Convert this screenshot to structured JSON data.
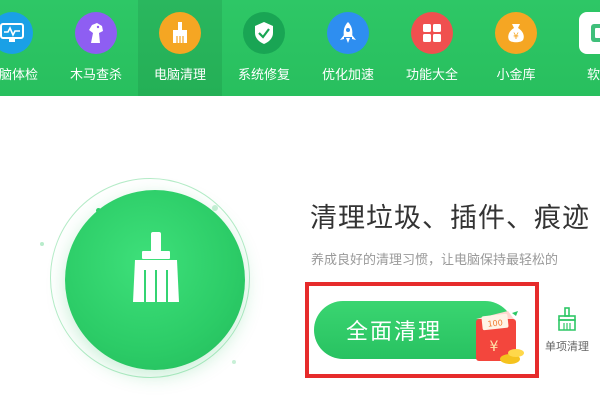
{
  "toolbar": {
    "items": [
      {
        "label": "电脑体检",
        "icon": "monitor-pulse-icon",
        "color": "#1aa0e6"
      },
      {
        "label": "木马查杀",
        "icon": "horse-icon",
        "color": "#8e5ef2"
      },
      {
        "label": "电脑清理",
        "icon": "broom-icon",
        "color": "#f5a623",
        "active": true
      },
      {
        "label": "系统修复",
        "icon": "shield-check-icon",
        "color": "#19a554"
      },
      {
        "label": "优化加速",
        "icon": "rocket-icon",
        "color": "#2e8ef0"
      },
      {
        "label": "功能大全",
        "icon": "grid-icon",
        "color": "#f0504f"
      },
      {
        "label": "小金库",
        "icon": "money-bag-icon",
        "color": "#f5a623"
      },
      {
        "label": "软件",
        "icon": "software-box-icon",
        "color": "#3fbf7a"
      }
    ]
  },
  "main": {
    "headline": "清理垃圾、插件、痕迹",
    "subtext": "养成良好的清理习惯，让电脑保持最轻松的",
    "clean_button": "全面清理",
    "envelope_badge": "100",
    "envelope_symbol": "¥",
    "single_clean_label": "单项清理"
  },
  "colors": {
    "brand_green": "#2ec766",
    "highlight_red": "#e62b2b"
  }
}
